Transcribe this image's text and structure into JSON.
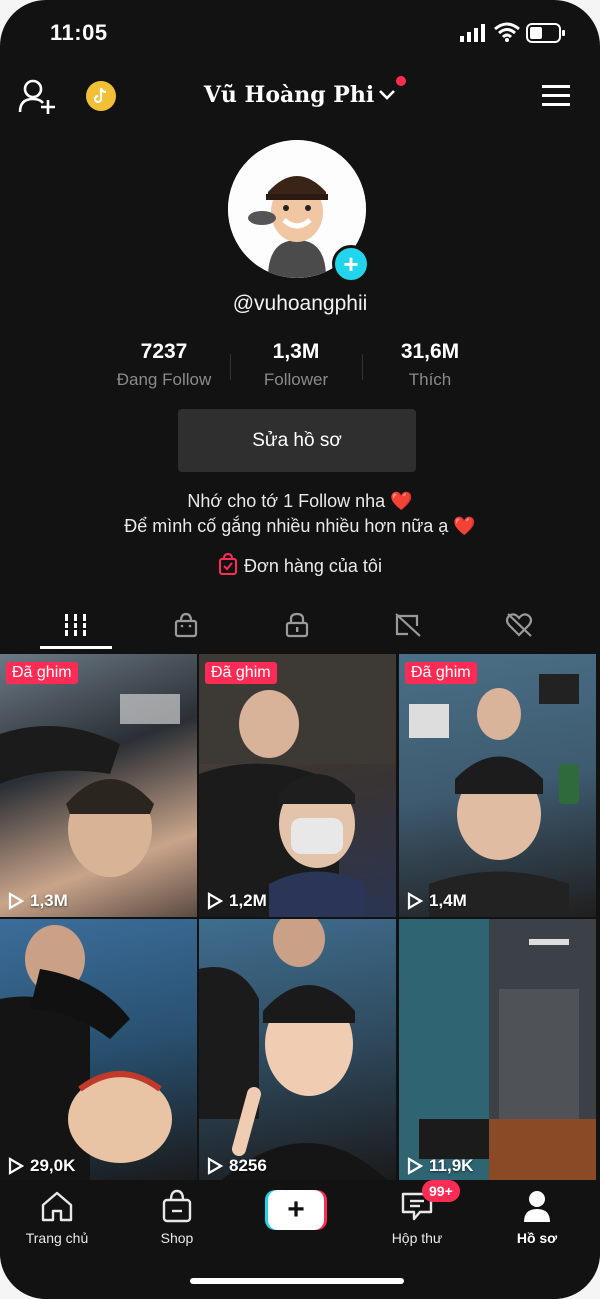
{
  "status_bar": {
    "time": "11:05"
  },
  "header": {
    "title": "Vũ Hoàng Phi"
  },
  "profile": {
    "handle": "@vuhoangphii",
    "stats": [
      {
        "value": "7237",
        "label": "Đang Follow"
      },
      {
        "value": "1,3M",
        "label": "Follower"
      },
      {
        "value": "31,6M",
        "label": "Thích"
      }
    ],
    "edit_button": "Sửa hồ sơ",
    "bio_lines": [
      "Nhớ cho tớ 1 Follow nha",
      "Để mình cố gắng nhiều nhiều hơn nữa ạ"
    ],
    "bio_emoji": "❤️",
    "orders_label": "Đơn hàng của tôi"
  },
  "tabs": [
    {
      "icon": "grid-icon",
      "active": true
    },
    {
      "icon": "shop-bag-icon"
    },
    {
      "icon": "lock-icon"
    },
    {
      "icon": "tagged-icon"
    },
    {
      "icon": "liked-heart-icon"
    }
  ],
  "videos": [
    {
      "pinned_label": "Đã ghim",
      "views": "1,3M"
    },
    {
      "pinned_label": "Đã ghim",
      "views": "1,2M"
    },
    {
      "pinned_label": "Đã ghim",
      "views": "1,4M"
    },
    {
      "pinned_label": "",
      "views": "29,0K"
    },
    {
      "pinned_label": "",
      "views": "8256"
    },
    {
      "pinned_label": "",
      "views": "11,9K"
    }
  ],
  "bottom_nav": {
    "home": "Trang chủ",
    "shop": "Shop",
    "inbox": "Hộp thư",
    "inbox_badge": "99+",
    "profile": "Hồ sơ"
  },
  "colors": {
    "accent": "#fe2c55",
    "cyan": "#20d5ec",
    "background": "#121212"
  }
}
